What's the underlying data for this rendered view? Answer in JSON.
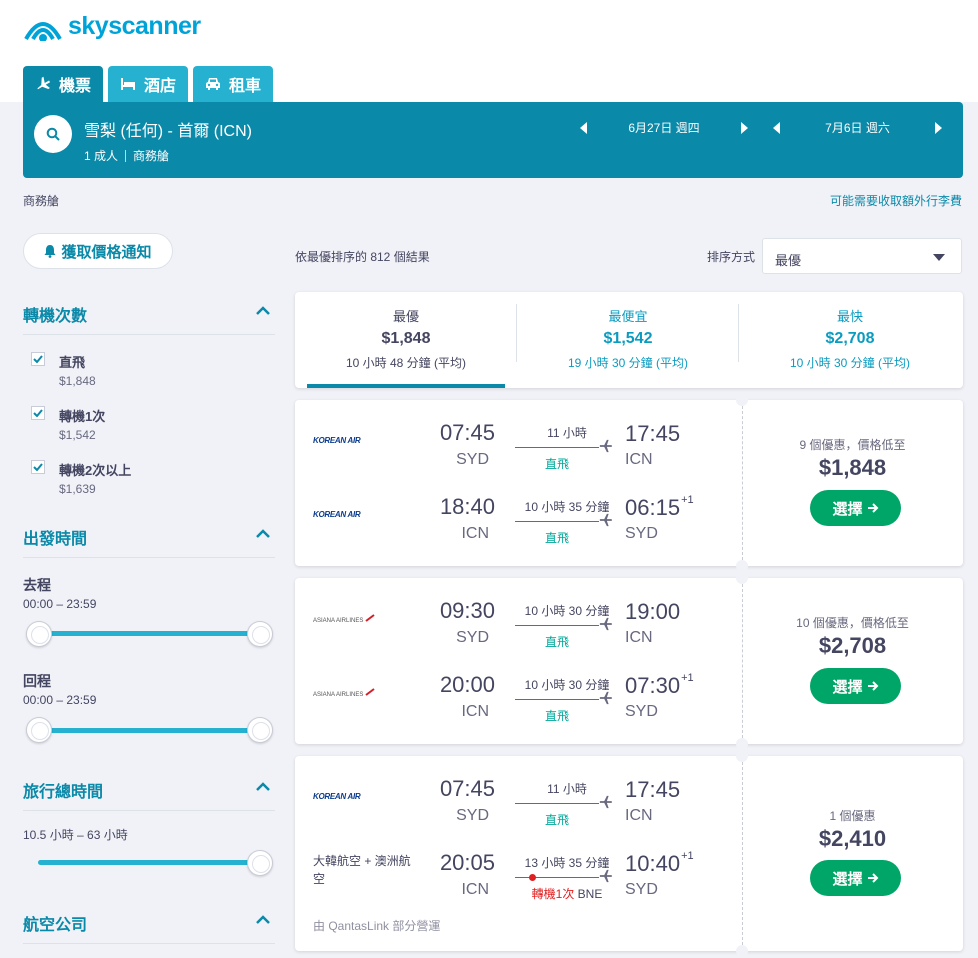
{
  "brand": {
    "name": "skyscanner",
    "color": "#00a3d8"
  },
  "tabs": [
    {
      "label": "機票",
      "icon": "plane-icon",
      "active": true
    },
    {
      "label": "酒店",
      "icon": "bed-icon",
      "active": false
    },
    {
      "label": "租車",
      "icon": "car-icon",
      "active": false
    }
  ],
  "search": {
    "route": "雪梨 (任何) - 首爾 (ICN)",
    "passengers": "1 成人",
    "cabin": "商務艙",
    "depart_date": "6月27日 週四",
    "return_date": "7月6日 週六"
  },
  "cabin_note": "商務艙",
  "bag_link": "可能需要收取額外行李費",
  "price_alert_label": "獲取價格通知",
  "filters": {
    "stops": {
      "title": "轉機次數",
      "options": [
        {
          "label": "直飛",
          "price": "$1,848",
          "checked": true
        },
        {
          "label": "轉機1次",
          "price": "$1,542",
          "checked": true
        },
        {
          "label": "轉機2次以上",
          "price": "$1,639",
          "checked": true
        }
      ]
    },
    "times": {
      "title": "出發時間",
      "outbound_label": "去程",
      "outbound_range": "00:00 – 23:59",
      "return_label": "回程",
      "return_range": "00:00 – 23:59"
    },
    "duration": {
      "title": "旅行總時間",
      "range": "10.5 小時 – 63 小時"
    },
    "airlines": {
      "title": "航空公司"
    }
  },
  "results": {
    "count_text": "依最優排序的 812 個結果",
    "sort_label": "排序方式",
    "sort_value": "最優"
  },
  "sort_tabs": [
    {
      "title": "最優",
      "price": "$1,848",
      "duration": "10 小時 48 分鐘 (平均)",
      "active": true
    },
    {
      "title": "最便宜",
      "price": "$1,542",
      "duration": "19 小時 30 分鐘 (平均)",
      "active": false
    },
    {
      "title": "最快",
      "price": "$2,708",
      "duration": "10 小時 30 分鐘 (平均)",
      "active": false
    }
  ],
  "itineraries": [
    {
      "deals": "9 個優惠，價格低至",
      "price": "$1,848",
      "select_label": "選擇",
      "legs": [
        {
          "airline": "KOREAN AIR",
          "dep_time": "07:45",
          "dep_code": "SYD",
          "arr_time": "17:45",
          "arr_code": "ICN",
          "plus": "",
          "duration": "11 小時",
          "stops": "直飛",
          "via": ""
        },
        {
          "airline": "KOREAN AIR",
          "dep_time": "18:40",
          "dep_code": "ICN",
          "arr_time": "06:15",
          "arr_code": "SYD",
          "plus": "+1",
          "duration": "10 小時 35 分鐘",
          "stops": "直飛",
          "via": ""
        }
      ]
    },
    {
      "deals": "10 個優惠，價格低至",
      "price": "$2,708",
      "select_label": "選擇",
      "legs": [
        {
          "airline": "ASIANA AIRLINES",
          "dep_time": "09:30",
          "dep_code": "SYD",
          "arr_time": "19:00",
          "arr_code": "ICN",
          "plus": "",
          "duration": "10 小時 30 分鐘",
          "stops": "直飛",
          "via": ""
        },
        {
          "airline": "ASIANA AIRLINES",
          "dep_time": "20:00",
          "dep_code": "ICN",
          "arr_time": "07:30",
          "arr_code": "SYD",
          "plus": "+1",
          "duration": "10 小時 30 分鐘",
          "stops": "直飛",
          "via": ""
        }
      ]
    },
    {
      "deals": "1 個優惠",
      "price": "$2,410",
      "select_label": "選擇",
      "operated_by": "由 QantasLink 部分營運",
      "legs": [
        {
          "airline": "KOREAN AIR",
          "dep_time": "07:45",
          "dep_code": "SYD",
          "arr_time": "17:45",
          "arr_code": "ICN",
          "plus": "",
          "duration": "11 小時",
          "stops": "直飛",
          "via": ""
        },
        {
          "airline": "大韓航空 + 澳洲航空",
          "dep_time": "20:05",
          "dep_code": "ICN",
          "arr_time": "10:40",
          "arr_code": "SYD",
          "plus": "+1",
          "duration": "13 小時 35 分鐘",
          "stops": "轉機1次",
          "via": "BNE"
        }
      ]
    }
  ],
  "colors": {
    "primary": "#0b89a8",
    "tab": "#25b1cf",
    "green": "#00a668",
    "direct": "#00a698",
    "stop": "#e02020"
  }
}
